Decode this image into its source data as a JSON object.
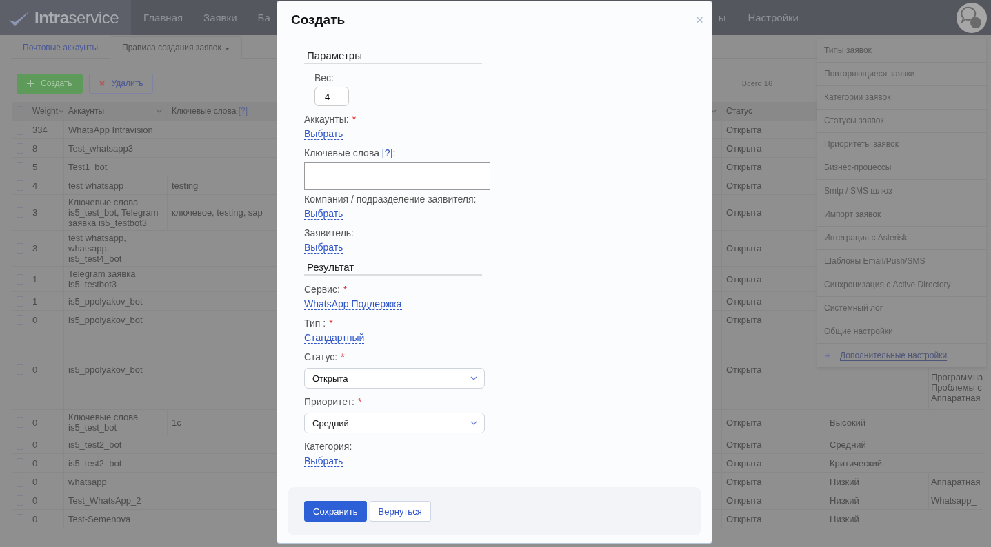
{
  "header": {
    "logo": "**Intra**service",
    "nav_left": [
      "Главная",
      "Заявки",
      "Ба"
    ],
    "nav_right": [
      "ы",
      "Настройки"
    ]
  },
  "subtabs": [
    {
      "label": "Почтовые аккаунты",
      "selected": false,
      "dropdown": false
    },
    {
      "label": "Правила создания заявок",
      "selected": true,
      "dropdown": true
    }
  ],
  "toolbar": {
    "buttons": [
      {
        "kind": "create",
        "label": "Создать"
      },
      {
        "kind": "delete",
        "label": "Удалить"
      }
    ],
    "total": "Всего 16"
  },
  "table": {
    "all_checked": false,
    "columns": [
      {
        "label": "Weight",
        "sortable": true
      },
      {
        "label": "Аккаунты",
        "sortable": true
      },
      {
        "label": "Ключевые слова",
        "help": "[?]",
        "sortable": true
      },
      {
        "label": "Статус",
        "sortable": false
      }
    ],
    "rows": [
      {
        "checked": false,
        "weight": "334",
        "accounts": "WhatsApp Intravision",
        "status": "Открыта"
      },
      {
        "checked": false,
        "weight": "8",
        "accounts": "Test_whatsapp3",
        "status": "Открыта"
      },
      {
        "checked": false,
        "weight": "5",
        "accounts": "Test1_bot",
        "status": "Открыта"
      },
      {
        "checked": false,
        "weight": "4",
        "accounts": "test whatsapp",
        "keywords": "testing",
        "status": "Открыта"
      },
      {
        "checked": false,
        "weight": "3",
        "accounts": "Ключевые слова\nis5_test_bot, Telegram\nзаявка is5_testbot3",
        "keywords": "ключевое, testing, sap",
        "status": "Открыта"
      },
      {
        "checked": false,
        "weight": "3",
        "accounts": "test whatsapp,\nwhatsapp,\nis5_test4_bot",
        "status": "Открыта"
      },
      {
        "checked": false,
        "weight": "1",
        "accounts": "Telegram заявка\nis5_testbot3",
        "status": "Открыта"
      },
      {
        "checked": false,
        "weight": "1",
        "accounts": "is5_ppolyakov_bot",
        "status": "Открыта"
      },
      {
        "checked": false,
        "weight": "0",
        "accounts": "is5_ppolyakov_bot",
        "status": "Открыта"
      },
      {
        "checked": false,
        "weight": "0",
        "accounts": "is5_ppolyakov_bot",
        "status": "Открыта",
        "category": [
          "Программна",
          "Проблемы с",
          "Аппаратная"
        ]
      },
      {
        "checked": false,
        "weight": "0",
        "accounts": "Ключевые слова\nis5_test_bot",
        "keywords": "1c",
        "status": "Открыта",
        "priority": "Высокий"
      },
      {
        "checked": false,
        "weight": "0",
        "accounts": "is5_test2_bot",
        "status": "Открыта",
        "priority": "Средний"
      },
      {
        "checked": false,
        "weight": "0",
        "accounts": "is5_test2_bot",
        "status": "Открыта",
        "priority": "Критический"
      },
      {
        "checked": false,
        "weight": "0",
        "accounts": "whatsapp",
        "status": "Открыта",
        "priority": "Низкий",
        "category": "Аппаратная"
      },
      {
        "checked": false,
        "weight": "0",
        "accounts": "Test_WhatsApp_2",
        "status": "Открыта",
        "priority": "Низкий",
        "category": "Whatsapp_"
      },
      {
        "checked": false,
        "weight": "0",
        "accounts": "Test-Semenova",
        "status": "Открыта",
        "priority": "Низкий"
      }
    ]
  },
  "settings_menu": {
    "items": [
      "Типы заявок",
      "Повторяющиеся заявки",
      "Категории заявок",
      "Статусы заявок",
      "Приоритеты заявок",
      "Бизнес-процессы",
      "Smtp / SMS шлюз",
      "Импорт заявок",
      "Интеграция с Asterisk",
      "Шаблоны Email/Push/SMS",
      "Синхронизация с Active Directory",
      "Системный лог",
      "Общие настройки"
    ],
    "more": "Дополнительные настройки"
  },
  "modal": {
    "title": "Создать",
    "close": "×",
    "sections": [
      {
        "title": "Параметры",
        "fields": [
          {
            "kind": "input",
            "label": "Вес:",
            "value": "4"
          },
          {
            "kind": "link",
            "label": "Аккаунты:",
            "mark": "*",
            "value": "Выбрать"
          },
          {
            "kind": "textarea",
            "label": "Ключевые слова",
            "help": "[?]",
            "suffix": ":"
          },
          {
            "kind": "link",
            "label": "Компания / подразделение заявителя:",
            "value": "Выбрать"
          },
          {
            "kind": "link",
            "label": "Заявитель:",
            "value": "Выбрать"
          }
        ]
      },
      {
        "title": "Результат",
        "fields": [
          {
            "kind": "link",
            "label": "Сервис:",
            "mark": "*",
            "value": "WhatsApp Поддержка"
          },
          {
            "kind": "link",
            "label": "Тип :",
            "mark": "*",
            "value": "Стандартный"
          },
          {
            "kind": "select",
            "label": "Статус:",
            "mark": "*",
            "value": "Открыта"
          },
          {
            "kind": "select",
            "label": "Приоритет:",
            "mark": "*",
            "value": "Средний"
          },
          {
            "kind": "link",
            "label": "Категория:",
            "value": "Выбрать"
          }
        ]
      }
    ],
    "buttons": [
      {
        "label": "Сохранить",
        "primary": true
      },
      {
        "label": "Вернуться",
        "primary": false
      }
    ]
  }
}
